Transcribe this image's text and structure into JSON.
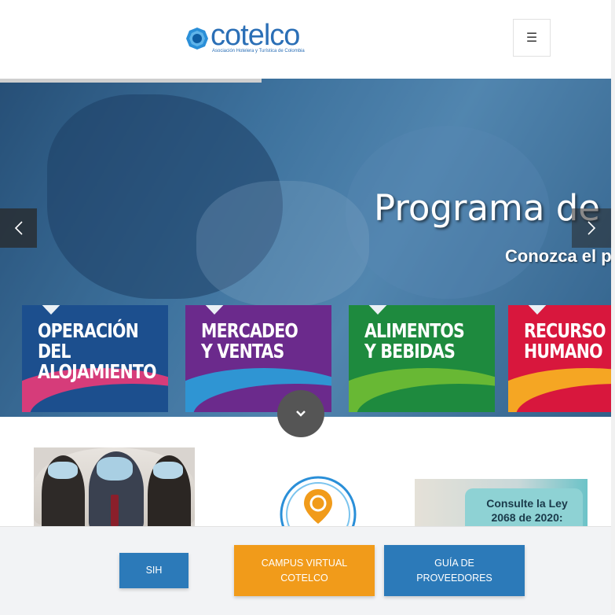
{
  "header": {
    "logo_text": "cotelco",
    "logo_tagline": "Asociación Hotelera y Turística de Colombia",
    "menu_icon": "hamburger-icon"
  },
  "hero": {
    "title": "Programa de",
    "subtitle": "Conozca el p",
    "prev_icon": "chevron-left-icon",
    "next_icon": "chevron-right-icon",
    "cards": [
      {
        "label": "OPERACIÓN DEL\nALOJAMIENTO",
        "color": "#1c4f8e"
      },
      {
        "label": "MERCADEO\nY VENTAS",
        "color": "#6b2a8c"
      },
      {
        "label": "ALIMENTOS\nY BEBIDAS",
        "color": "#1e8a3e"
      },
      {
        "label": "RECURSO\nHUMANO",
        "color": "#d8173d"
      }
    ],
    "scroll_icon": "chevron-down-icon"
  },
  "thumbnails": {
    "law_text": "Consulte la Ley\n2068 de 2020:"
  },
  "bottom_bar": {
    "sih_label": "SIH",
    "campus_label": "CAMPUS VIRTUAL\nCOTELCO",
    "guia_label": "GUÍA DE\nPROVEEDORES"
  },
  "colors": {
    "brand_blue": "#2c7ab9",
    "brand_orange": "#f19b1a"
  }
}
